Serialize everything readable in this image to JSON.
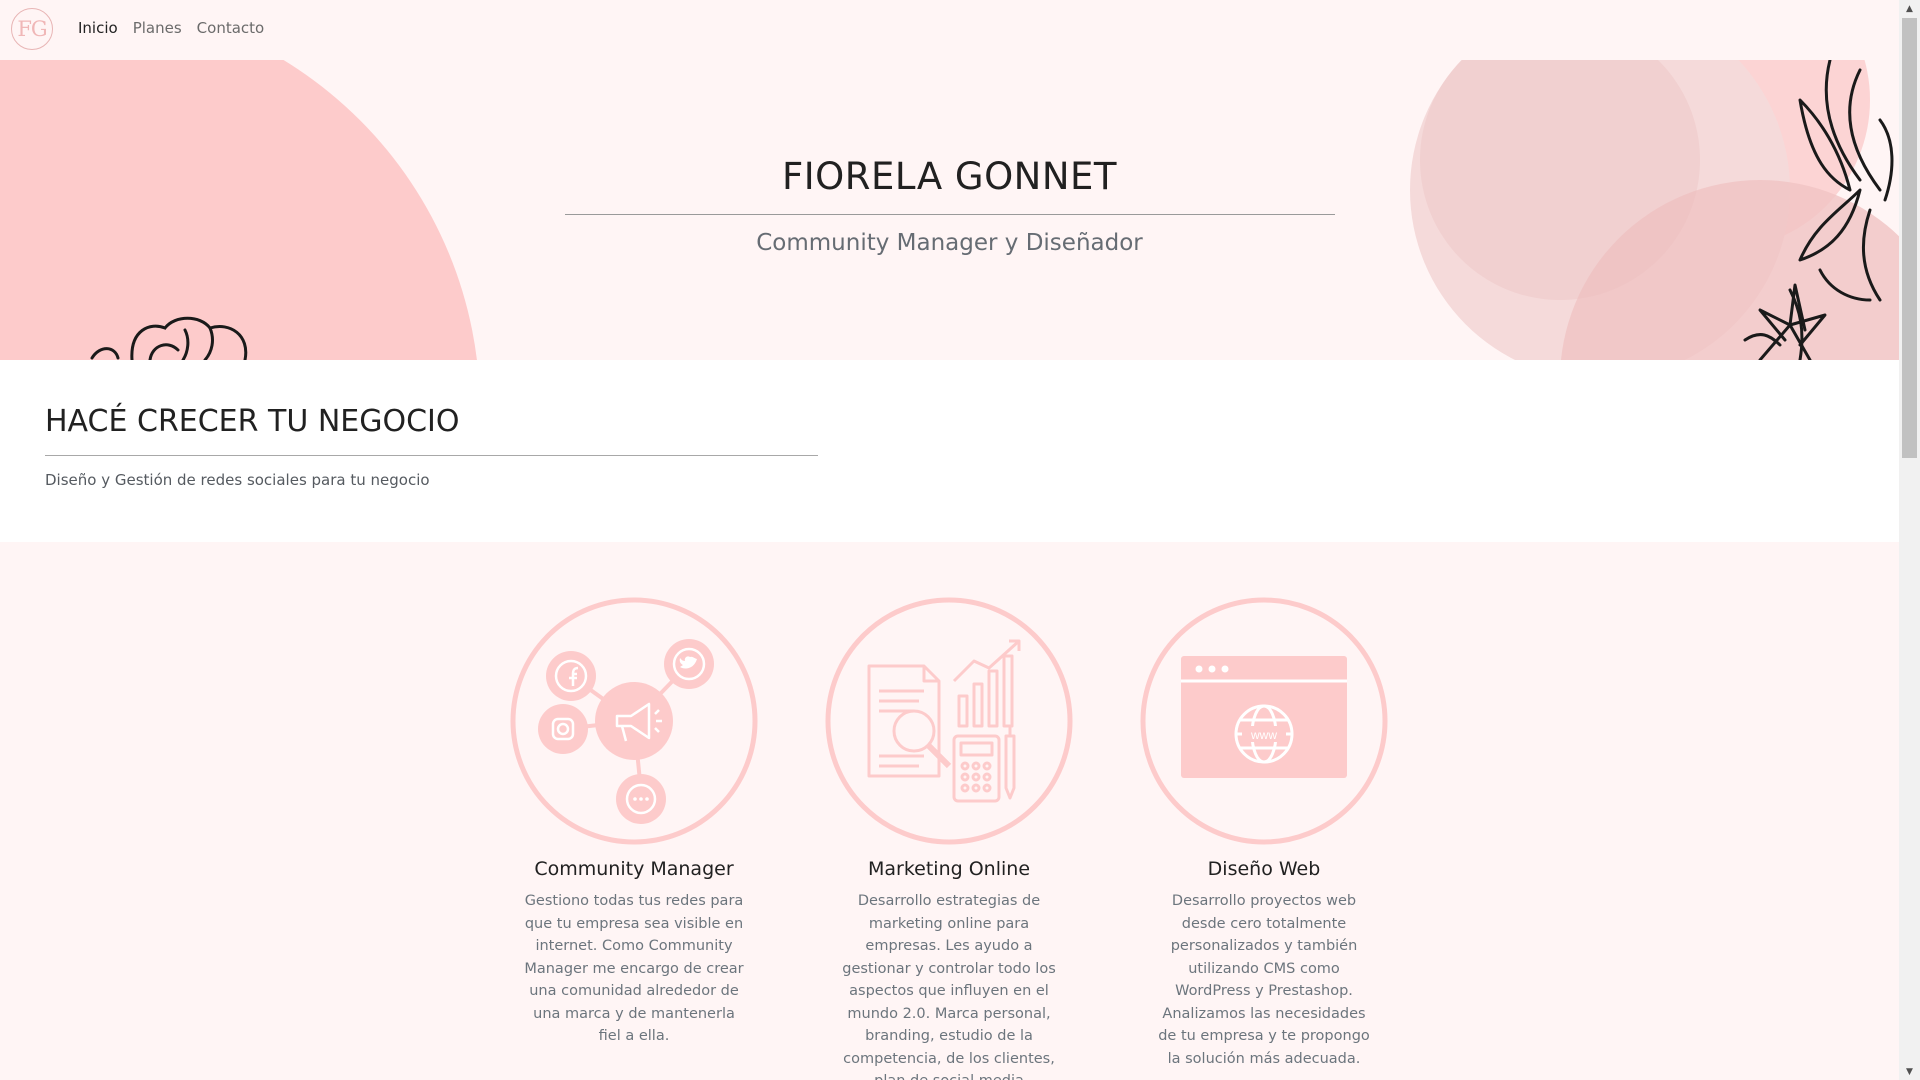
{
  "nav": {
    "logo_text": "FG",
    "links": [
      {
        "label": "Inicio",
        "active": true
      },
      {
        "label": "Planes",
        "active": false
      },
      {
        "label": "Contacto",
        "active": false
      }
    ]
  },
  "hero": {
    "title": "FIORELA GONNET",
    "subtitle": "Community Manager y Diseñador"
  },
  "intro": {
    "title": "HACÉ CRECER TU NEGOCIO",
    "text": "Diseño y Gestión de redes sociales para tu negocio"
  },
  "services": [
    {
      "title": "Community Manager",
      "icon": "social-network-icon",
      "text": "Gestiono todas tus redes para que tu empresa sea visible en internet. Como Community Manager me encargo de crear una comunidad alrededor de una marca y de mantenerla fiel a ella."
    },
    {
      "title": "Marketing Online",
      "icon": "marketing-analytics-icon",
      "text": "Desarrollo estrategias de marketing online para empresas. Les ayudo a gestionar y controlar todo los aspectos que influyen en el mundo 2.0. Marca personal, branding, estudio de la competencia, de los clientes, plan de social media"
    },
    {
      "title": "Diseño Web",
      "icon": "web-browser-icon",
      "text": "Desarrollo proyectos web desde cero totalmente personalizados y también utilizando CMS como WordPress y Prestashop. Analizamos las necesidades de tu empresa y te propongo la solución más adecuada."
    }
  ],
  "colors": {
    "accent_pink": "#fdcbcb",
    "background": "#fff5f5",
    "text_dark": "#212121",
    "text_muted": "#6c757d"
  }
}
